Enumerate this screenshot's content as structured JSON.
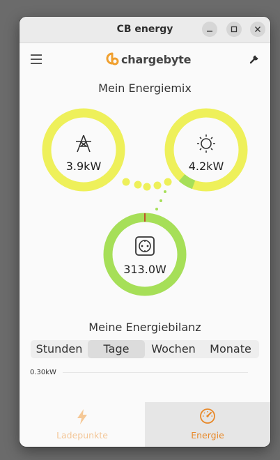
{
  "window": {
    "title": "CB energy"
  },
  "app": {
    "logo_text": "chargebyte"
  },
  "mix": {
    "heading": "Mein Energiemix",
    "grid_value": "3.9kW",
    "solar_value": "4.2kW",
    "consumption_value": "313.0W"
  },
  "balance": {
    "heading": "Meine Energiebilanz",
    "tabs": [
      "Stunden",
      "Tage",
      "Wochen",
      "Monate"
    ],
    "active_tab": "Tage",
    "axis_top": "0.30kW"
  },
  "nav": {
    "items": [
      {
        "label": "Ladepunkte",
        "icon": "lightning-icon"
      },
      {
        "label": "Energie",
        "icon": "speedometer-icon"
      }
    ],
    "active": "Energie"
  },
  "colors": {
    "accent": "#f0a030",
    "grid_ring": "#eef05a",
    "consumption_ring": "#a6df58",
    "window_bg": "#fafafa"
  }
}
